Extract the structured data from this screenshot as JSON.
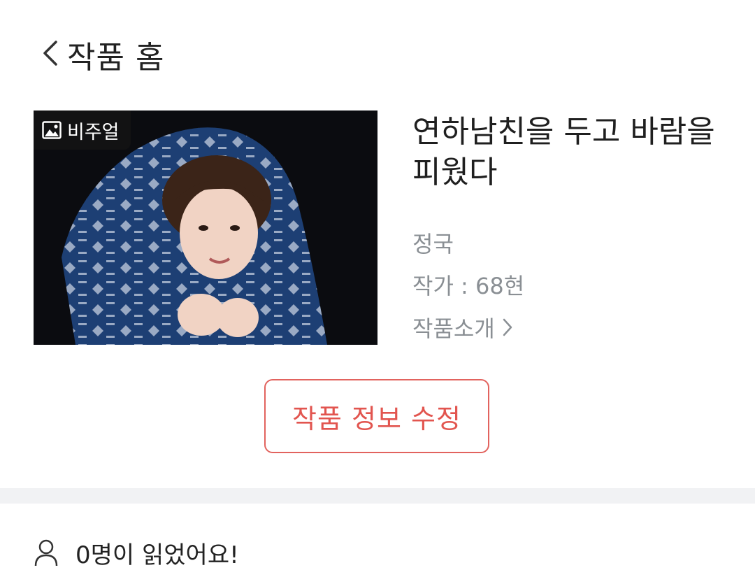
{
  "header": {
    "title": "작품 홈",
    "back_icon": "chevron-left-icon"
  },
  "cover": {
    "badge_label": "비주얼",
    "badge_icon": "image-icon"
  },
  "work": {
    "title": "연하남친을 두고 바람을 피웠다",
    "character": "정국",
    "author": "작가 : 68현",
    "intro_link": "작품소개"
  },
  "edit_button": {
    "label": "작품 정보 수정",
    "color": "#e2554f"
  },
  "readers": {
    "text": "0명이 읽었어요!",
    "icon": "person-icon"
  }
}
